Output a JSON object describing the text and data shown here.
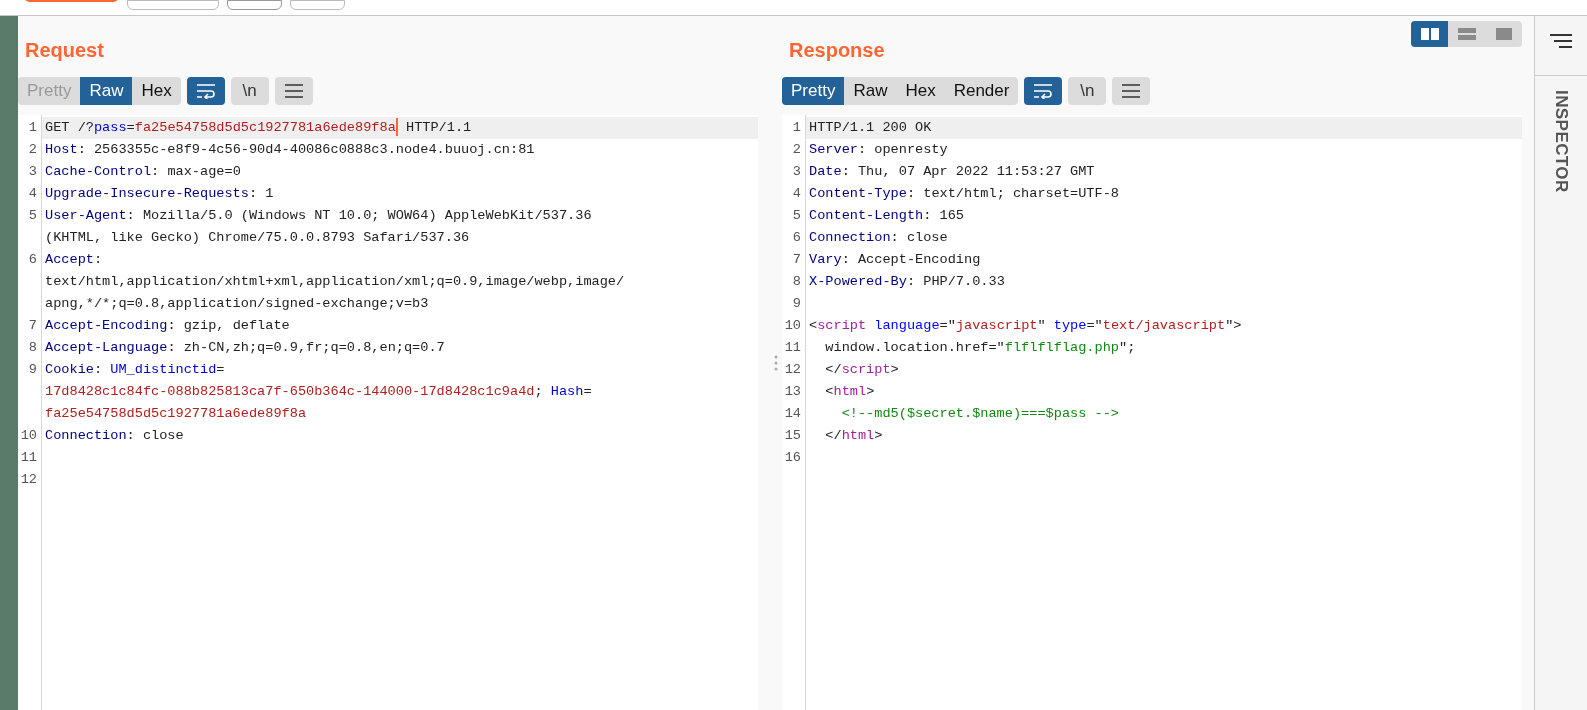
{
  "request": {
    "title": "Request",
    "tabs": [
      {
        "label": "Pretty",
        "selected": false,
        "disabled": true
      },
      {
        "label": "Raw",
        "selected": true,
        "disabled": false
      },
      {
        "label": "Hex",
        "selected": false,
        "disabled": false
      }
    ],
    "tools": [
      {
        "kind": "wrap",
        "selected": true
      },
      {
        "kind": "newline",
        "label": "\\n",
        "selected": false
      },
      {
        "kind": "menu",
        "selected": false
      }
    ],
    "lines": [
      {
        "number": "1",
        "selected": true,
        "rows": [
          {
            "spans": [
              {
                "kind": "text",
                "text": "GET /?"
              },
              {
                "kind": "param",
                "text": "pass"
              },
              {
                "kind": "text",
                "text": "="
              },
              {
                "kind": "value",
                "text": "fa25e54758d5d5c1927781a6ede89f8a",
                "cursor": true
              },
              {
                "kind": "text",
                "text": " HTTP/1.1"
              }
            ]
          }
        ]
      },
      {
        "number": "2",
        "selected": false,
        "rows": [
          {
            "spans": [
              {
                "kind": "key",
                "text": "Host"
              },
              {
                "kind": "text",
                "text": ": 2563355c-e8f9-4c56-90d4-40086c0888c3.node4.buuoj.cn:81"
              }
            ]
          }
        ]
      },
      {
        "number": "3",
        "selected": false,
        "rows": [
          {
            "spans": [
              {
                "kind": "key",
                "text": "Cache-Control"
              },
              {
                "kind": "text",
                "text": ": max-age=0"
              }
            ]
          }
        ]
      },
      {
        "number": "4",
        "selected": false,
        "rows": [
          {
            "spans": [
              {
                "kind": "key",
                "text": "Upgrade-Insecure-Requests"
              },
              {
                "kind": "text",
                "text": ": 1"
              }
            ]
          }
        ]
      },
      {
        "number": "5",
        "selected": false,
        "rows": [
          {
            "spans": [
              {
                "kind": "key",
                "text": "User-Agent"
              },
              {
                "kind": "text",
                "text": ": Mozilla/5.0 (Windows NT 10.0; WOW64) AppleWebKit/537.36"
              }
            ]
          },
          {
            "spans": [
              {
                "kind": "text",
                "text": "(KHTML, like Gecko) Chrome/75.0.0.8793 Safari/537.36"
              }
            ]
          }
        ]
      },
      {
        "number": "6",
        "selected": false,
        "rows": [
          {
            "spans": [
              {
                "kind": "key",
                "text": "Accept"
              },
              {
                "kind": "text",
                "text": ":"
              }
            ]
          },
          {
            "spans": [
              {
                "kind": "text",
                "text": "text/html,application/xhtml+xml,application/xml;q=0.9,image/webp,image/"
              }
            ]
          },
          {
            "spans": [
              {
                "kind": "text",
                "text": "apng,*/*;q=0.8,application/signed-exchange;v=b3"
              }
            ]
          }
        ]
      },
      {
        "number": "7",
        "selected": false,
        "rows": [
          {
            "spans": [
              {
                "kind": "key",
                "text": "Accept-Encoding"
              },
              {
                "kind": "text",
                "text": ": gzip, deflate"
              }
            ]
          }
        ]
      },
      {
        "number": "8",
        "selected": false,
        "rows": [
          {
            "spans": [
              {
                "kind": "key",
                "text": "Accept-Language"
              },
              {
                "kind": "text",
                "text": ": zh-CN,zh;q=0.9,fr;q=0.8,en;q=0.7"
              }
            ]
          }
        ]
      },
      {
        "number": "9",
        "selected": false,
        "rows": [
          {
            "spans": [
              {
                "kind": "key",
                "text": "Cookie"
              },
              {
                "kind": "text",
                "text": ": "
              },
              {
                "kind": "param",
                "text": "UM_distinctid"
              },
              {
                "kind": "text",
                "text": "="
              }
            ]
          },
          {
            "spans": [
              {
                "kind": "value",
                "text": "17d8428c1c84fc-088b825813ca7f-650b364c-144000-17d8428c1c9a4d"
              },
              {
                "kind": "text",
                "text": "; "
              },
              {
                "kind": "param",
                "text": "Hash"
              },
              {
                "kind": "text",
                "text": "="
              }
            ]
          },
          {
            "spans": [
              {
                "kind": "value",
                "text": "fa25e54758d5d5c1927781a6ede89f8a"
              }
            ]
          }
        ]
      },
      {
        "number": "10",
        "selected": false,
        "rows": [
          {
            "spans": [
              {
                "kind": "key",
                "text": "Connection"
              },
              {
                "kind": "text",
                "text": ": close"
              }
            ]
          }
        ]
      },
      {
        "number": "11",
        "selected": false,
        "rows": [
          {
            "spans": []
          }
        ]
      },
      {
        "number": "12",
        "selected": false,
        "rows": [
          {
            "spans": []
          }
        ]
      }
    ]
  },
  "response": {
    "title": "Response",
    "tabs": [
      {
        "label": "Pretty",
        "selected": true,
        "disabled": false
      },
      {
        "label": "Raw",
        "selected": false,
        "disabled": false
      },
      {
        "label": "Hex",
        "selected": false,
        "disabled": false
      },
      {
        "label": "Render",
        "selected": false,
        "disabled": false
      }
    ],
    "tools": [
      {
        "kind": "wrap",
        "selected": true
      },
      {
        "kind": "newline",
        "label": "\\n",
        "selected": false
      },
      {
        "kind": "menu",
        "selected": false
      }
    ],
    "lines": [
      {
        "number": "1",
        "selected": true,
        "rows": [
          {
            "spans": [
              {
                "kind": "text",
                "text": "HTTP/1.1 200 OK"
              }
            ]
          }
        ]
      },
      {
        "number": "2",
        "selected": false,
        "rows": [
          {
            "spans": [
              {
                "kind": "key",
                "text": "Server"
              },
              {
                "kind": "text",
                "text": ": openresty"
              }
            ]
          }
        ]
      },
      {
        "number": "3",
        "selected": false,
        "rows": [
          {
            "spans": [
              {
                "kind": "key",
                "text": "Date"
              },
              {
                "kind": "text",
                "text": ": Thu, 07 Apr 2022 11:53:27 GMT"
              }
            ]
          }
        ]
      },
      {
        "number": "4",
        "selected": false,
        "rows": [
          {
            "spans": [
              {
                "kind": "key",
                "text": "Content-Type"
              },
              {
                "kind": "text",
                "text": ": text/html; charset=UTF-8"
              }
            ]
          }
        ]
      },
      {
        "number": "5",
        "selected": false,
        "rows": [
          {
            "spans": [
              {
                "kind": "key",
                "text": "Content-Length"
              },
              {
                "kind": "text",
                "text": ": 165"
              }
            ]
          }
        ]
      },
      {
        "number": "6",
        "selected": false,
        "rows": [
          {
            "spans": [
              {
                "kind": "key",
                "text": "Connection"
              },
              {
                "kind": "text",
                "text": ": close"
              }
            ]
          }
        ]
      },
      {
        "number": "7",
        "selected": false,
        "rows": [
          {
            "spans": [
              {
                "kind": "key",
                "text": "Vary"
              },
              {
                "kind": "text",
                "text": ": Accept-Encoding"
              }
            ]
          }
        ]
      },
      {
        "number": "8",
        "selected": false,
        "rows": [
          {
            "spans": [
              {
                "kind": "key",
                "text": "X-Powered-By"
              },
              {
                "kind": "text",
                "text": ": PHP/7.0.33"
              }
            ]
          }
        ]
      },
      {
        "number": "9",
        "selected": false,
        "rows": [
          {
            "spans": []
          }
        ]
      },
      {
        "number": "10",
        "selected": false,
        "rows": [
          {
            "spans": [
              {
                "kind": "text",
                "text": "<"
              },
              {
                "kind": "tag",
                "text": "script"
              },
              {
                "kind": "attr",
                "text": " language"
              },
              {
                "kind": "text",
                "text": "=\""
              },
              {
                "kind": "value",
                "text": "javascript"
              },
              {
                "kind": "text",
                "text": "\" "
              },
              {
                "kind": "attr",
                "text": "type"
              },
              {
                "kind": "text",
                "text": "=\""
              },
              {
                "kind": "value",
                "text": "text/javascript"
              },
              {
                "kind": "text",
                "text": "\">"
              }
            ]
          }
        ]
      },
      {
        "number": "11",
        "selected": false,
        "rows": [
          {
            "spans": [
              {
                "kind": "text",
                "text": "  window.location.href=\""
              },
              {
                "kind": "string",
                "text": "flflflflag.php"
              },
              {
                "kind": "text",
                "text": "\";"
              }
            ]
          }
        ]
      },
      {
        "number": "12",
        "selected": false,
        "rows": [
          {
            "spans": [
              {
                "kind": "text",
                "text": "  </"
              },
              {
                "kind": "tag",
                "text": "script"
              },
              {
                "kind": "text",
                "text": ">"
              }
            ]
          }
        ]
      },
      {
        "number": "13",
        "selected": false,
        "rows": [
          {
            "spans": [
              {
                "kind": "text",
                "text": "  <"
              },
              {
                "kind": "tag",
                "text": "html"
              },
              {
                "kind": "text",
                "text": ">"
              }
            ]
          }
        ]
      },
      {
        "number": "14",
        "selected": false,
        "rows": [
          {
            "spans": [
              {
                "kind": "comment",
                "text": "    <!--md5($secret.$name)===$pass -->"
              }
            ]
          }
        ]
      },
      {
        "number": "15",
        "selected": false,
        "rows": [
          {
            "spans": [
              {
                "kind": "text",
                "text": "  </"
              },
              {
                "kind": "tag",
                "text": "html"
              },
              {
                "kind": "text",
                "text": ">"
              }
            ]
          }
        ]
      },
      {
        "number": "16",
        "selected": false,
        "rows": [
          {
            "spans": []
          }
        ]
      }
    ]
  },
  "layout_buttons": [
    {
      "kind": "side-by-side",
      "selected": true
    },
    {
      "kind": "stacked",
      "selected": false
    },
    {
      "kind": "single",
      "selected": false
    }
  ],
  "inspector": {
    "title": "INSPECTOR"
  }
}
